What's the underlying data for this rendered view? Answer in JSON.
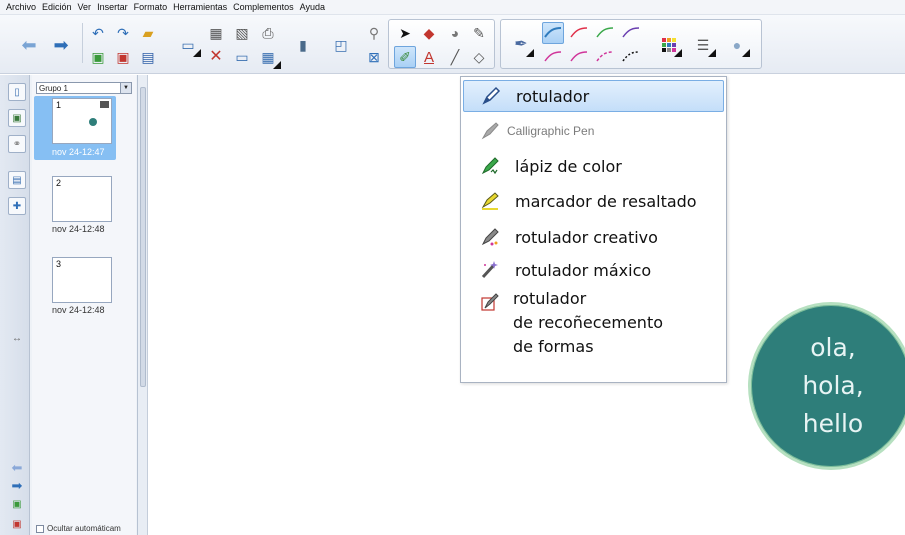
{
  "menubar": {
    "items": [
      "Archivo",
      "Edición",
      "Ver",
      "Insertar",
      "Formato",
      "Herramientas",
      "Complementos",
      "Ayuda"
    ]
  },
  "toolbar": {
    "colors": {
      "pen_red": "#e0304a",
      "pen_green": "#3aa84a",
      "pen_purple": "#6a3fb0",
      "pen_magenta": "#d0359a",
      "pen_teal": "#2f7bbd"
    }
  },
  "sidepanel": {
    "group_name": "Grupo 1",
    "pages": [
      {
        "number": "1",
        "timestamp": "nov 24-12:47",
        "selected": true
      },
      {
        "number": "2",
        "timestamp": "nov 24-12:48",
        "selected": false
      },
      {
        "number": "3",
        "timestamp": "nov 24-12:48",
        "selected": false
      }
    ],
    "autohide_label": "Ocultar automáticam"
  },
  "pen_menu": {
    "items": [
      {
        "label": "rotulador",
        "icon": "marker-pen-icon",
        "selected": true
      },
      {
        "label": "Calligraphic Pen",
        "icon": "calligraphy-pen-icon",
        "disabled": true
      },
      {
        "label": "lápiz de color",
        "icon": "crayon-icon"
      },
      {
        "label": "marcador de resaltado",
        "icon": "highlighter-icon"
      },
      {
        "label": "rotulador creativo",
        "icon": "creative-pen-icon"
      },
      {
        "label": "rotulador máxico",
        "icon": "magic-pen-icon"
      }
    ],
    "shape_pen": {
      "line1": "rotulador",
      "line2": "de recoñecemento",
      "line3": "de formas",
      "icon": "shape-recognition-pen-icon"
    }
  },
  "canvas": {
    "bubble": {
      "line1": "ola,",
      "line2": "hola,",
      "line3": "hello",
      "fill": "#2e7e7a"
    }
  }
}
